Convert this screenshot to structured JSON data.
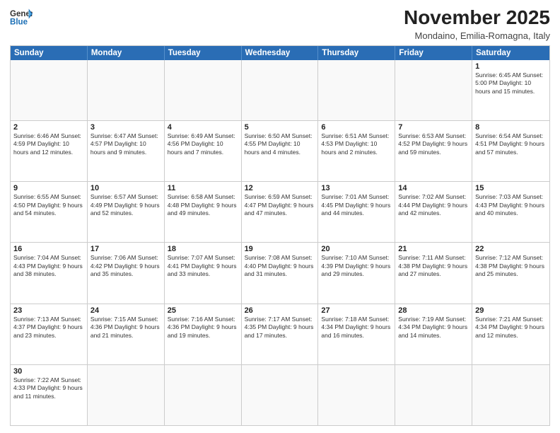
{
  "header": {
    "logo_general": "General",
    "logo_blue": "Blue",
    "month_title": "November 2025",
    "location": "Mondaino, Emilia-Romagna, Italy"
  },
  "days_of_week": [
    "Sunday",
    "Monday",
    "Tuesday",
    "Wednesday",
    "Thursday",
    "Friday",
    "Saturday"
  ],
  "weeks": [
    [
      {
        "day": "",
        "text": ""
      },
      {
        "day": "",
        "text": ""
      },
      {
        "day": "",
        "text": ""
      },
      {
        "day": "",
        "text": ""
      },
      {
        "day": "",
        "text": ""
      },
      {
        "day": "",
        "text": ""
      },
      {
        "day": "1",
        "text": "Sunrise: 6:45 AM\nSunset: 5:00 PM\nDaylight: 10 hours\nand 15 minutes."
      }
    ],
    [
      {
        "day": "2",
        "text": "Sunrise: 6:46 AM\nSunset: 4:59 PM\nDaylight: 10 hours\nand 12 minutes."
      },
      {
        "day": "3",
        "text": "Sunrise: 6:47 AM\nSunset: 4:57 PM\nDaylight: 10 hours\nand 9 minutes."
      },
      {
        "day": "4",
        "text": "Sunrise: 6:49 AM\nSunset: 4:56 PM\nDaylight: 10 hours\nand 7 minutes."
      },
      {
        "day": "5",
        "text": "Sunrise: 6:50 AM\nSunset: 4:55 PM\nDaylight: 10 hours\nand 4 minutes."
      },
      {
        "day": "6",
        "text": "Sunrise: 6:51 AM\nSunset: 4:53 PM\nDaylight: 10 hours\nand 2 minutes."
      },
      {
        "day": "7",
        "text": "Sunrise: 6:53 AM\nSunset: 4:52 PM\nDaylight: 9 hours\nand 59 minutes."
      },
      {
        "day": "8",
        "text": "Sunrise: 6:54 AM\nSunset: 4:51 PM\nDaylight: 9 hours\nand 57 minutes."
      }
    ],
    [
      {
        "day": "9",
        "text": "Sunrise: 6:55 AM\nSunset: 4:50 PM\nDaylight: 9 hours\nand 54 minutes."
      },
      {
        "day": "10",
        "text": "Sunrise: 6:57 AM\nSunset: 4:49 PM\nDaylight: 9 hours\nand 52 minutes."
      },
      {
        "day": "11",
        "text": "Sunrise: 6:58 AM\nSunset: 4:48 PM\nDaylight: 9 hours\nand 49 minutes."
      },
      {
        "day": "12",
        "text": "Sunrise: 6:59 AM\nSunset: 4:47 PM\nDaylight: 9 hours\nand 47 minutes."
      },
      {
        "day": "13",
        "text": "Sunrise: 7:01 AM\nSunset: 4:45 PM\nDaylight: 9 hours\nand 44 minutes."
      },
      {
        "day": "14",
        "text": "Sunrise: 7:02 AM\nSunset: 4:44 PM\nDaylight: 9 hours\nand 42 minutes."
      },
      {
        "day": "15",
        "text": "Sunrise: 7:03 AM\nSunset: 4:43 PM\nDaylight: 9 hours\nand 40 minutes."
      }
    ],
    [
      {
        "day": "16",
        "text": "Sunrise: 7:04 AM\nSunset: 4:43 PM\nDaylight: 9 hours\nand 38 minutes."
      },
      {
        "day": "17",
        "text": "Sunrise: 7:06 AM\nSunset: 4:42 PM\nDaylight: 9 hours\nand 35 minutes."
      },
      {
        "day": "18",
        "text": "Sunrise: 7:07 AM\nSunset: 4:41 PM\nDaylight: 9 hours\nand 33 minutes."
      },
      {
        "day": "19",
        "text": "Sunrise: 7:08 AM\nSunset: 4:40 PM\nDaylight: 9 hours\nand 31 minutes."
      },
      {
        "day": "20",
        "text": "Sunrise: 7:10 AM\nSunset: 4:39 PM\nDaylight: 9 hours\nand 29 minutes."
      },
      {
        "day": "21",
        "text": "Sunrise: 7:11 AM\nSunset: 4:38 PM\nDaylight: 9 hours\nand 27 minutes."
      },
      {
        "day": "22",
        "text": "Sunrise: 7:12 AM\nSunset: 4:38 PM\nDaylight: 9 hours\nand 25 minutes."
      }
    ],
    [
      {
        "day": "23",
        "text": "Sunrise: 7:13 AM\nSunset: 4:37 PM\nDaylight: 9 hours\nand 23 minutes."
      },
      {
        "day": "24",
        "text": "Sunrise: 7:15 AM\nSunset: 4:36 PM\nDaylight: 9 hours\nand 21 minutes."
      },
      {
        "day": "25",
        "text": "Sunrise: 7:16 AM\nSunset: 4:36 PM\nDaylight: 9 hours\nand 19 minutes."
      },
      {
        "day": "26",
        "text": "Sunrise: 7:17 AM\nSunset: 4:35 PM\nDaylight: 9 hours\nand 17 minutes."
      },
      {
        "day": "27",
        "text": "Sunrise: 7:18 AM\nSunset: 4:34 PM\nDaylight: 9 hours\nand 16 minutes."
      },
      {
        "day": "28",
        "text": "Sunrise: 7:19 AM\nSunset: 4:34 PM\nDaylight: 9 hours\nand 14 minutes."
      },
      {
        "day": "29",
        "text": "Sunrise: 7:21 AM\nSunset: 4:34 PM\nDaylight: 9 hours\nand 12 minutes."
      }
    ],
    [
      {
        "day": "30",
        "text": "Sunrise: 7:22 AM\nSunset: 4:33 PM\nDaylight: 9 hours\nand 11 minutes."
      },
      {
        "day": "",
        "text": ""
      },
      {
        "day": "",
        "text": ""
      },
      {
        "day": "",
        "text": ""
      },
      {
        "day": "",
        "text": ""
      },
      {
        "day": "",
        "text": ""
      },
      {
        "day": "",
        "text": ""
      }
    ]
  ]
}
